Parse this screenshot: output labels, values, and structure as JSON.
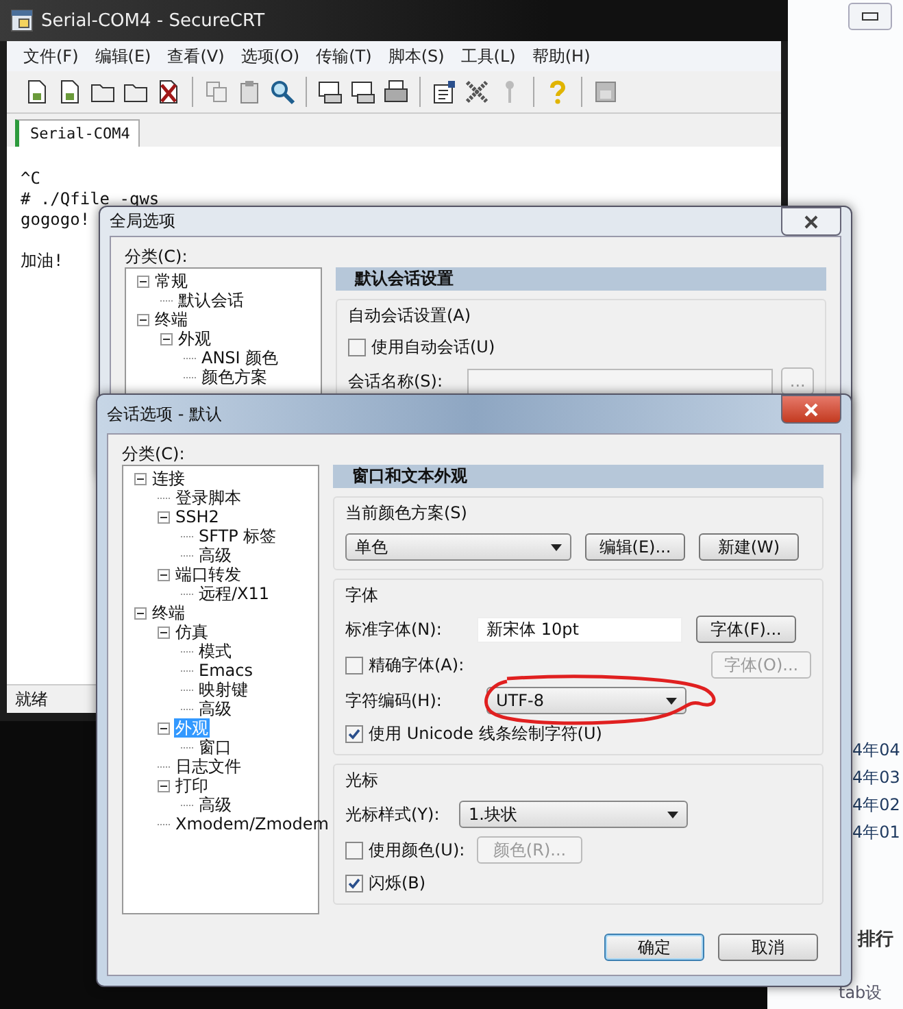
{
  "background_window": {
    "list_items": [
      "4年04",
      "4年03",
      "4年02",
      "4年01"
    ],
    "heading": "排行",
    "footer_text": "tab设"
  },
  "main_window": {
    "title": "Serial-COM4 - SecureCRT",
    "menu": [
      "文件(F)",
      "编辑(E)",
      "查看(V)",
      "选项(O)",
      "传输(T)",
      "脚本(S)",
      "工具(L)",
      "帮助(H)"
    ],
    "tabs": [
      {
        "label": "Serial-COM4",
        "selected": true
      }
    ],
    "terminal_blocks": [
      [
        "^C",
        "# ./Qfile -qws",
        "gogogo!"
      ],
      [
        "加油!"
      ]
    ],
    "status_bar": "就绪"
  },
  "global_options_dialog": {
    "title": "全局选项",
    "category_label": "分类(C):",
    "tree": [
      {
        "label": "常规",
        "selected": false,
        "expanded": true,
        "children": [
          {
            "label": "默认会话",
            "selected": false
          }
        ]
      },
      {
        "label": "终端",
        "selected": false,
        "expanded": true,
        "children": [
          {
            "label": "外观",
            "selected": false,
            "expanded": true,
            "children": [
              {
                "label": "ANSI 颜色",
                "selected": false
              },
              {
                "label": "颜色方案",
                "selected": false
              }
            ]
          }
        ]
      }
    ],
    "section_title": "默认会话设置",
    "group_label": "自动会话设置(A)",
    "auto_session": {
      "label": "使用自动会话(U)",
      "checked": false
    },
    "session_name_label": "会话名称(S):",
    "browse_button": "..."
  },
  "session_options_dialog": {
    "title": "会话选项 - 默认",
    "category_label": "分类(C):",
    "tree": [
      {
        "label": "连接",
        "selected": false,
        "expanded": true,
        "children": [
          {
            "label": "登录脚本",
            "selected": false
          },
          {
            "label": "SSH2",
            "selected": false,
            "expanded": true,
            "children": [
              {
                "label": "SFTP 标签",
                "selected": false
              },
              {
                "label": "高级",
                "selected": false
              }
            ]
          },
          {
            "label": "端口转发",
            "selected": false,
            "expanded": true,
            "children": [
              {
                "label": "远程/X11",
                "selected": false
              }
            ]
          }
        ]
      },
      {
        "label": "终端",
        "selected": false,
        "expanded": true,
        "children": [
          {
            "label": "仿真",
            "selected": false,
            "expanded": true,
            "children": [
              {
                "label": "模式",
                "selected": false
              },
              {
                "label": "Emacs",
                "selected": false
              },
              {
                "label": "映射键",
                "selected": false
              },
              {
                "label": "高级",
                "selected": false
              }
            ]
          },
          {
            "label": "外观",
            "selected": true,
            "expanded": true,
            "children": [
              {
                "label": "窗口",
                "selected": false
              }
            ]
          },
          {
            "label": "日志文件",
            "selected": false
          },
          {
            "label": "打印",
            "selected": false,
            "expanded": true,
            "children": [
              {
                "label": "高级",
                "selected": false
              }
            ]
          },
          {
            "label": "Xmodem/Zmodem",
            "selected": false
          }
        ]
      }
    ],
    "section_title": "窗口和文本外观",
    "color_scheme": {
      "group_label": "当前颜色方案(S)",
      "value": "单色",
      "edit_button": "编辑(E)...",
      "new_button": "新建(W)"
    },
    "font": {
      "group_label": "字体",
      "standard_font_label": "标准字体(N):",
      "standard_font_value": "新宋体 10pt",
      "font_button": "字体(F)...",
      "precise_font": {
        "label": "精确字体(A):",
        "checked": false
      },
      "precise_font_button": {
        "label": "字体(O)...",
        "disabled": true
      },
      "encoding_label": "字符编码(H):",
      "encoding_value": "UTF-8",
      "unicode_lines": {
        "label": "使用 Unicode 线条绘制字符(U)",
        "checked": true
      }
    },
    "cursor": {
      "group_label": "光标",
      "style_label": "光标样式(Y):",
      "style_value": "1.块状",
      "use_color": {
        "label": "使用颜色(U):",
        "checked": false
      },
      "color_button": {
        "label": "颜色(R)...",
        "disabled": true
      },
      "blink": {
        "label": "闪烁(B)",
        "checked": true
      }
    },
    "buttons": [
      {
        "label": "确定",
        "default": true
      },
      {
        "label": "取消",
        "default": false
      }
    ]
  }
}
